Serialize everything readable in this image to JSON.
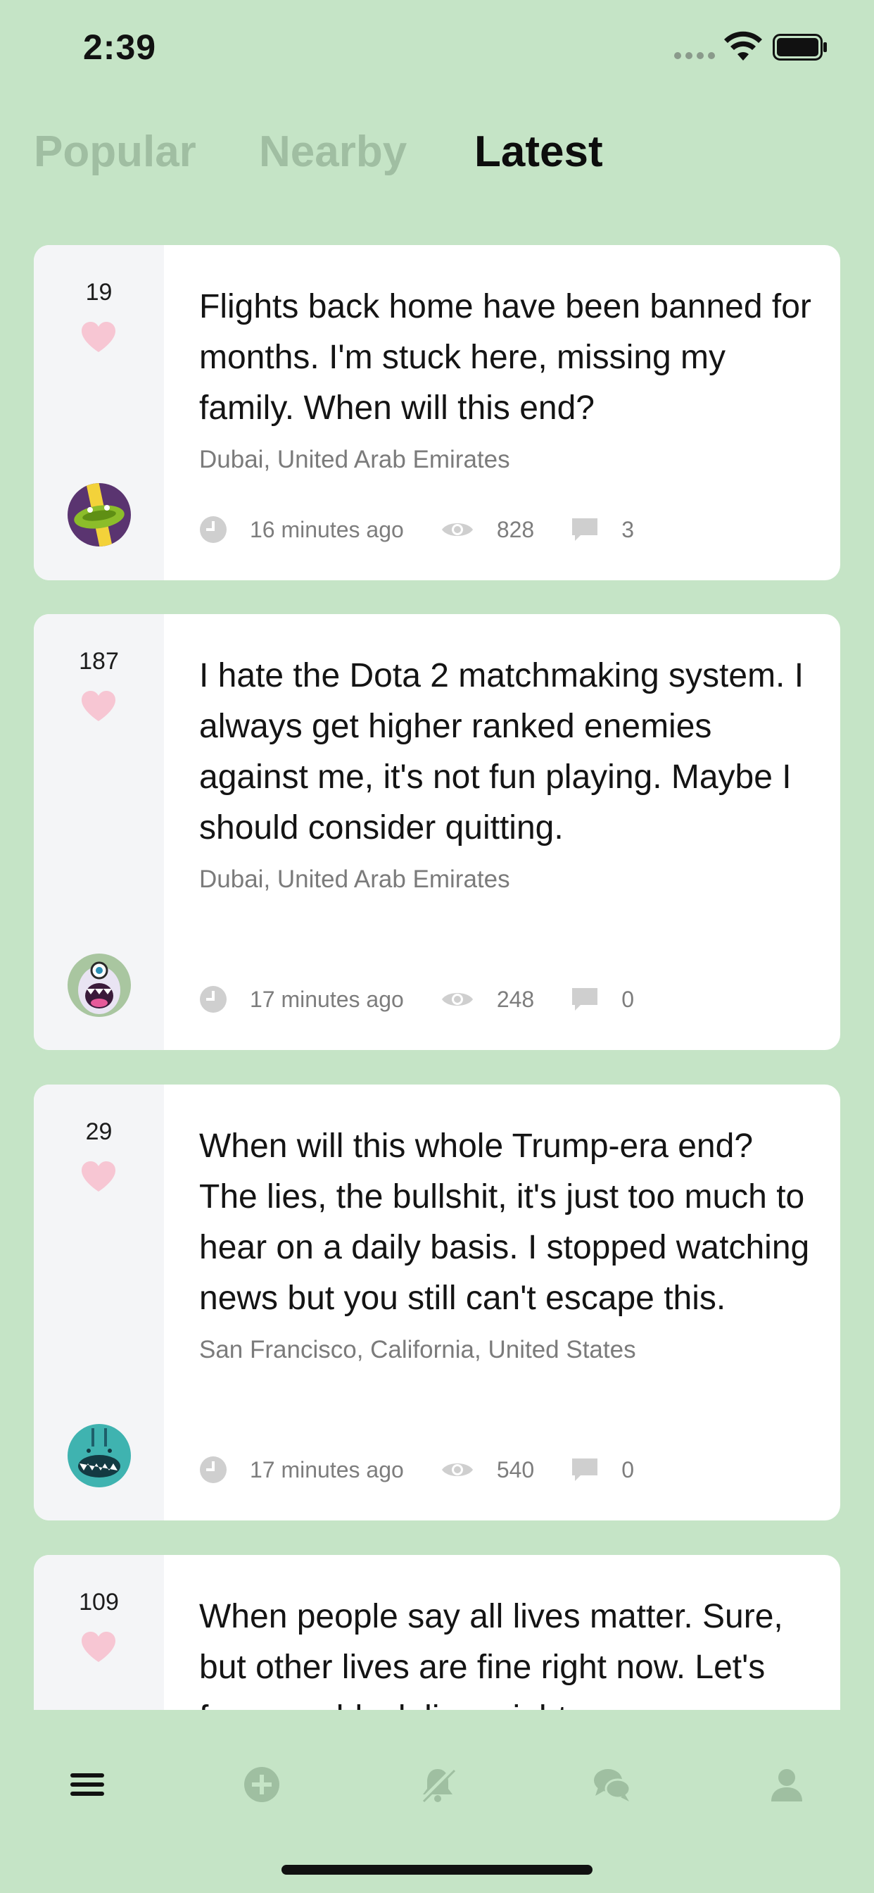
{
  "status_bar": {
    "time": "2:39"
  },
  "tabs": [
    {
      "label": "Popular",
      "active": false
    },
    {
      "label": "Nearby",
      "active": false
    },
    {
      "label": "Latest",
      "active": true
    }
  ],
  "posts": [
    {
      "likes": "19",
      "text": "Flights back home have been banned for months. I'm stuck here, missing my family. When will this end?",
      "location": "Dubai, United Arab Emirates",
      "time": "16 minutes ago",
      "views": "828",
      "comments": "3",
      "avatar": "cucumber-avatar"
    },
    {
      "likes": "187",
      "text": "I hate the Dota 2 matchmaking system. I always get higher ranked enemies against me, it's not fun playing. Maybe I should consider quitting.",
      "location": "Dubai, United Arab Emirates",
      "time": "17 minutes ago",
      "views": "248",
      "comments": "0",
      "avatar": "cyclops-monster-avatar"
    },
    {
      "likes": "29",
      "text": "When will this whole Trump-era end? The lies, the bullshit, it's just too much to hear on a daily basis. I stopped watching news but you still can't escape this.",
      "location": "San Francisco, California, United States",
      "time": "17 minutes ago",
      "views": "540",
      "comments": "0",
      "avatar": "teal-monster-avatar"
    },
    {
      "likes": "109",
      "text": "When people say all lives matter. Sure, but other lives are fine right now. Let's focus on black lives right",
      "location": "",
      "time": "",
      "views": "",
      "comments": "",
      "avatar": ""
    }
  ],
  "bottom_nav": [
    "menu-icon",
    "add-post-icon",
    "notifications-off-icon",
    "chat-icon",
    "profile-icon"
  ],
  "colors": {
    "background": "#c5e4c6",
    "heart": "#f7c6d3",
    "tab_inactive": "#a0bea2",
    "nav_icon_inactive": "#9fbfa1"
  }
}
